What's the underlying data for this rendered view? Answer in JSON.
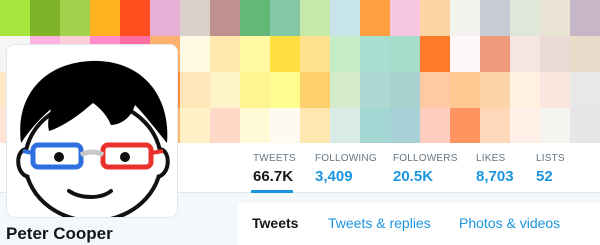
{
  "profile": {
    "name": "Peter Cooper"
  },
  "stats": [
    {
      "label": "TWEETS",
      "value": "66.7K",
      "active": true
    },
    {
      "label": "FOLLOWING",
      "value": "3,409",
      "active": false
    },
    {
      "label": "FOLLOWERS",
      "value": "20.5K",
      "active": false
    },
    {
      "label": "LIKES",
      "value": "8,703",
      "active": false
    },
    {
      "label": "LISTS",
      "value": "52",
      "active": false
    }
  ],
  "tabs": [
    {
      "label": "Tweets",
      "active": true
    },
    {
      "label": "Tweets & replies",
      "active": false
    },
    {
      "label": "Photos & videos",
      "active": false
    }
  ],
  "banner": {
    "rows": [
      [
        "#a7e63f",
        "#7fb32a",
        "#a2d14b",
        "#ffb21f",
        "#ff4f1f",
        "#e7b0d6",
        "#d9d0cb",
        "#c08f8f",
        "#63b878",
        "#83c8a6",
        "#c6e9a9",
        "#c7e4ec",
        "#ff9f40",
        "#f6c7e1",
        "#fcd4a4",
        "#f2f2ee",
        "#c6ccd2",
        "#dfe8d8",
        "#e9e3d4",
        "#c7b7c6"
      ],
      [
        "#f6f6f6",
        "#ffb1e0",
        "#ffcdd7",
        "#ff8bc8",
        "#ff6ca3",
        "#ffb06d",
        "#fef9e2",
        "#ffe7ad",
        "#fff9a1",
        "#ffde3f",
        "#ffe18e",
        "#c4ecc6",
        "#a9dfd0",
        "#a6dcc9",
        "#ff7a29",
        "#fef7f9",
        "#ef9a7b",
        "#f6e6e1",
        "#ead9d4",
        "#e6dcc9"
      ],
      [
        "#ffe7c8",
        "#f77c3a",
        "#ffd0a4",
        "#f9b28b",
        "#ff5a2f",
        "#ff8c42",
        "#ffe7b9",
        "#fff4c9",
        "#fff48f",
        "#fffd8f",
        "#ffd16d",
        "#d3ebcb",
        "#add8d2",
        "#a9d1d0",
        "#ffc9a3",
        "#ffc994",
        "#fbd4a7",
        "#fff0e0",
        "#fbe6df",
        "#e8e8e8"
      ],
      [
        "#ffe4d6",
        "#f8a876",
        "#ffc48a",
        "#ffd49d",
        "#ff9a3a",
        "#ffb76b",
        "#fff0c7",
        "#ffd9c7",
        "#fff9d6",
        "#fffaf0",
        "#ffe8b0",
        "#d9ebe7",
        "#a4d6d4",
        "#a6d1d6",
        "#ffcec0",
        "#ff9460",
        "#ffd7b9",
        "#ffefe7",
        "#f5f5f0",
        "#e6e6e6"
      ]
    ]
  }
}
